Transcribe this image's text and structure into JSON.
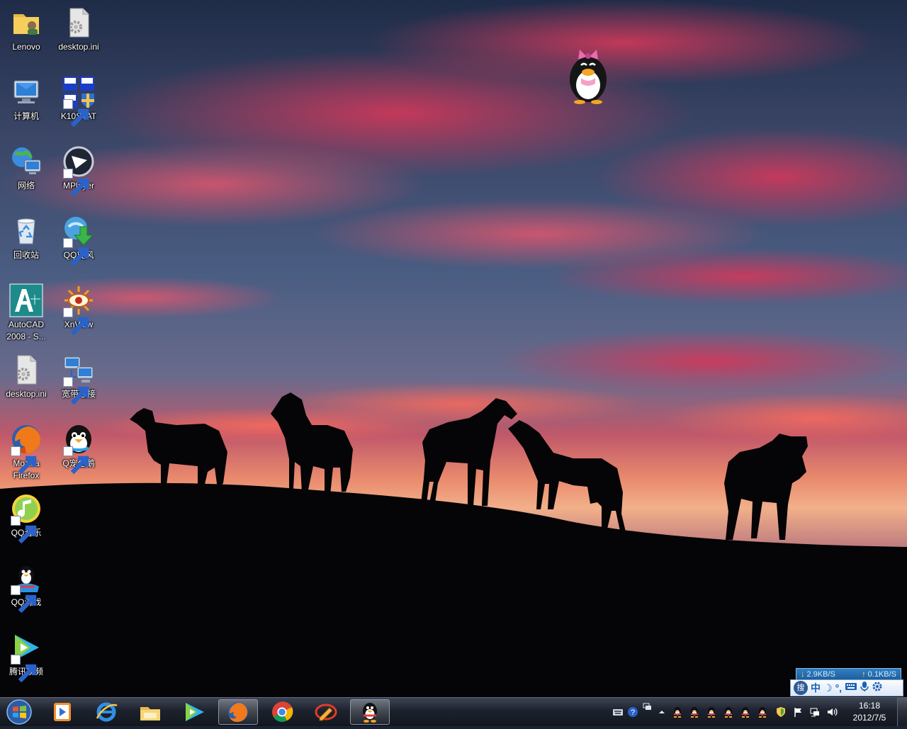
{
  "desktop": {
    "icons": [
      {
        "label": "Lenovo"
      },
      {
        "label": "desktop.ini"
      },
      {
        "label": "计算机"
      },
      {
        "label": "K10STAT"
      },
      {
        "label": "网络"
      },
      {
        "label": "MPlayer"
      },
      {
        "label": "回收站"
      },
      {
        "label": "QQ旋风"
      },
      {
        "label": "AutoCAD\n2008 - S..."
      },
      {
        "label": "XnView"
      },
      {
        "label": "desktop.ini"
      },
      {
        "label": "宽带连接"
      },
      {
        "label": "Mozilla\nFirefox"
      },
      {
        "label": "Q宠企鹅"
      },
      {
        "label": "QQ音乐"
      },
      {
        "label": "QQ游戏"
      },
      {
        "label": "腾讯视频"
      }
    ]
  },
  "net_speed": {
    "down": "2.9KB/S",
    "up": "0.1KB/S"
  },
  "ime": {
    "logo": "搜",
    "mode": "中",
    "moon": "☽",
    "punct": "°,"
  },
  "taskbar": {
    "pinned": [
      "media-player",
      "internet-explorer",
      "file-explorer",
      "tencent-video",
      "firefox",
      "chrome",
      "edit-tool",
      "qq"
    ],
    "active": "firefox"
  },
  "clock": {
    "time": "16:18",
    "date": "2012/7/5"
  },
  "colors": {
    "taskbar": "#1c222d",
    "accent": "#2f7fc4"
  }
}
